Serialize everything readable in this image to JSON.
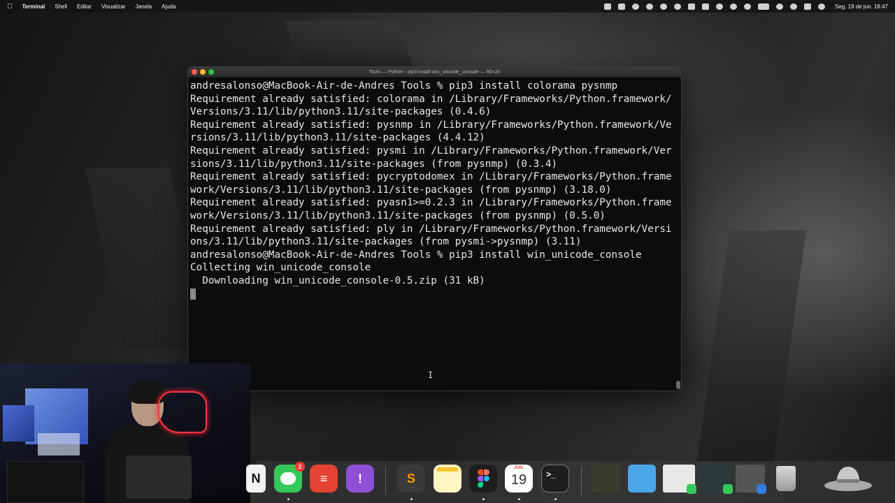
{
  "menubar": {
    "app_name": "Terminal",
    "menus": [
      "Shell",
      "Editar",
      "Visualizar",
      "Janela",
      "Ajuda"
    ],
    "clock": "Seg. 19 de jun.  18:47"
  },
  "terminal": {
    "title": "Tools — Python ‹ pip3 install win_unicode_console — 80×24",
    "lines": [
      "andresalonso@MacBook-Air-de-Andres Tools % pip3 install colorama pysnmp",
      "Requirement already satisfied: colorama in /Library/Frameworks/Python.framework/",
      "Versions/3.11/lib/python3.11/site-packages (0.4.6)",
      "Requirement already satisfied: pysnmp in /Library/Frameworks/Python.framework/Ve",
      "rsions/3.11/lib/python3.11/site-packages (4.4.12)",
      "Requirement already satisfied: pysmi in /Library/Frameworks/Python.framework/Ver",
      "sions/3.11/lib/python3.11/site-packages (from pysnmp) (0.3.4)",
      "Requirement already satisfied: pycryptodomex in /Library/Frameworks/Python.frame",
      "work/Versions/3.11/lib/python3.11/site-packages (from pysnmp) (3.18.0)",
      "Requirement already satisfied: pyasn1>=0.2.3 in /Library/Frameworks/Python.frame",
      "work/Versions/3.11/lib/python3.11/site-packages (from pysnmp) (0.5.0)",
      "Requirement already satisfied: ply in /Library/Frameworks/Python.framework/Versi",
      "ons/3.11/lib/python3.11/site-packages (from pysmi->pysnmp) (3.11)",
      "andresalonso@MacBook-Air-de-Andres Tools % pip3 install win_unicode_console",
      "Collecting win_unicode_console",
      "  Downloading win_unicode_console-0.5.zip (31 kB)"
    ]
  },
  "dock": {
    "messages_badge": "2",
    "calendar_month": "JUN.",
    "calendar_day": "19",
    "terminal_prompt": ">_"
  },
  "colors": {
    "close": "#fe5f57",
    "minimize": "#febc2e",
    "maximize": "#28c840",
    "terminal_bg": "#0c0c0c",
    "terminal_text": "#e8e8e8"
  }
}
